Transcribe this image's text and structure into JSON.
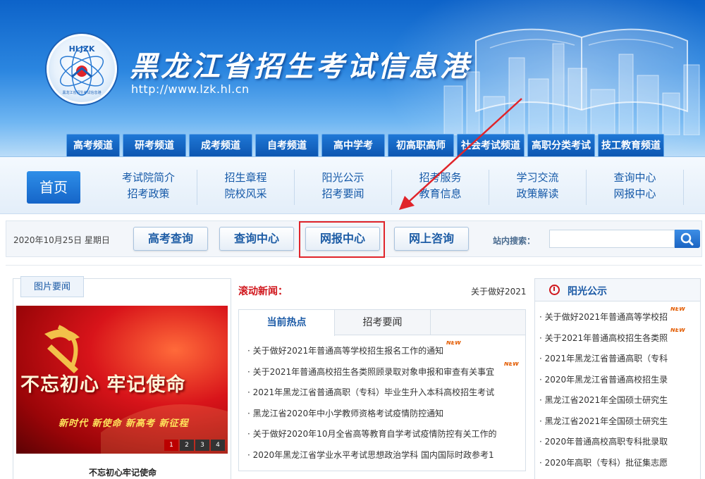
{
  "header": {
    "site_title": "黑龙江省招生考试信息港",
    "site_url": "http://www.lzk.hl.cn",
    "logo_text": "HLJZK",
    "logo_subtext": "黑龙江省招生考试信息港"
  },
  "channel_tabs": [
    "高考频道",
    "研考频道",
    "成考频道",
    "自考频道",
    "高中学考",
    "初高职高师",
    "社会考试频道",
    "高职分类考试",
    "技工教育频道"
  ],
  "main_nav": {
    "home": "首页",
    "groups": [
      [
        "考试院简介",
        "招考政策"
      ],
      [
        "招生章程",
        "院校风采"
      ],
      [
        "阳光公示",
        "招考要闻"
      ],
      [
        "招考服务",
        "教育信息"
      ],
      [
        "学习交流",
        "政策解读"
      ],
      [
        "查询中心",
        "网报中心"
      ]
    ]
  },
  "toolbar": {
    "date": "2020年10月25日 星期日",
    "buttons": [
      "高考查询",
      "查询中心",
      "网报中心",
      "网上咨询"
    ],
    "search_label": "站内搜索：",
    "search_value": ""
  },
  "picture_news": {
    "tab": "图片要闻",
    "slogan": "不忘初心 牢记使命",
    "sub_slogan": "新时代  新使命  新高考  新征程",
    "caption": "不忘初心牢记使命",
    "pages": [
      "1",
      "2",
      "3",
      "4"
    ]
  },
  "scroll_news": {
    "label": "滚动新闻：",
    "text": "关于做好2021年"
  },
  "hot_news": {
    "tabs": [
      "当前热点",
      "招考要闻"
    ],
    "new_label": "NEW",
    "items": [
      "关于做好2021年普通高等学校招生报名工作的通知",
      "关于2021年普通高校招生各类照顾录取对象申报和审查有关事宜",
      "2021年黑龙江省普通高职（专科）毕业生升入本科高校招生考试",
      "黑龙江省2020年中小学教师资格考试疫情防控通知",
      "关于做好2020年10月全省高等教育自学考试疫情防控有关工作的",
      "2020年黑龙江省学业水平考试思想政治学科 国内国际时政参考1"
    ]
  },
  "sunshine": {
    "title": "阳光公示",
    "new_label": "NEW",
    "items": [
      "关于做好2021年普通高等学校招",
      "关于2021年普通高校招生各类照",
      "2021年黑龙江省普通高职（专科",
      "2020年黑龙江省普通高校招生录",
      "黑龙江省2021年全国硕士研究生",
      "黑龙江省2021年全国硕士研究生",
      "2020年普通高校高职专科批录取",
      "2020年高职（专科）批征集志愿"
    ]
  },
  "colors": {
    "brand_blue": "#1565c8",
    "highlight_red": "#e0242a",
    "news_red": "#d0161c"
  }
}
